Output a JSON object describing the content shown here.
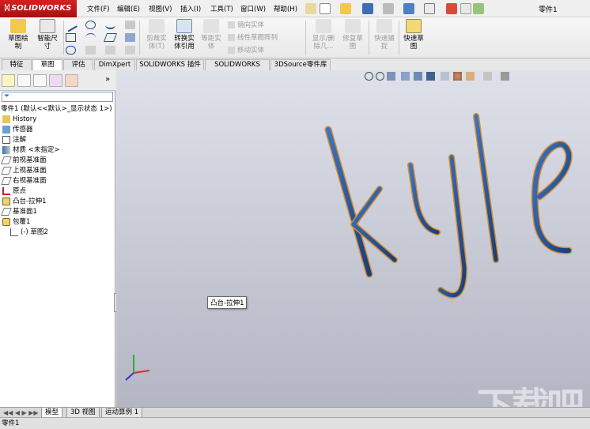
{
  "app": {
    "logo_text": "SOLIDWORKS",
    "doc_title": "零件1"
  },
  "menu": [
    "文件(F)",
    "编辑(E)",
    "视图(V)",
    "插入(I)",
    "工具(T)",
    "窗口(W)",
    "帮助(H)"
  ],
  "commands": {
    "sketch": "草图绘\n制",
    "smart_dim": "智能尺\n寸",
    "trim": "剪裁实\n体(T)",
    "convert": "转换实\n体引用",
    "offset": "等距实\n体",
    "mirror": "镜向实体",
    "linear_pattern": "线性草图阵列",
    "move": "移动实体",
    "display_delete": "显示/删\n除几...",
    "repair": "修复草\n图",
    "quick_snap": "快速捕\n捉",
    "rapid_sketch": "快速草\n图"
  },
  "tabs": [
    "特征",
    "草图",
    "评估",
    "DimXpert",
    "SOLIDWORKS 插件",
    "SOLIDWORKS MBD",
    "3DSource零件库"
  ],
  "active_tab": "草图",
  "tree": {
    "root": "零件1  (默认<<默认>_显示状态 1>)",
    "items": [
      {
        "label": "History",
        "icon": "history-icon"
      },
      {
        "label": "传感器",
        "icon": "sensor-icon"
      },
      {
        "label": "注解",
        "icon": "annotation-icon"
      },
      {
        "label": "材质 <未指定>",
        "icon": "material-icon"
      },
      {
        "label": "前视基准面",
        "icon": "plane-icon"
      },
      {
        "label": "上视基准面",
        "icon": "plane-icon"
      },
      {
        "label": "右视基准面",
        "icon": "plane-icon"
      },
      {
        "label": "原点",
        "icon": "origin-icon"
      },
      {
        "label": "凸台-拉伸1",
        "icon": "extrude-icon"
      },
      {
        "label": "基准面1",
        "icon": "plane-icon"
      },
      {
        "label": "包覆1",
        "icon": "wrap-icon"
      },
      {
        "label": "(-) 草图2",
        "icon": "sketch-icon"
      }
    ]
  },
  "tooltip": "凸台-拉伸1",
  "model_text": "kyle",
  "bottom_tabs": [
    "模型",
    "3D 视图",
    "运动算例 1"
  ],
  "status": "零件1",
  "watermark": "下载吧",
  "colors": {
    "accent": "#c8102e",
    "model_blue": "#1f5fae",
    "edge_orange": "#d98a2a"
  }
}
